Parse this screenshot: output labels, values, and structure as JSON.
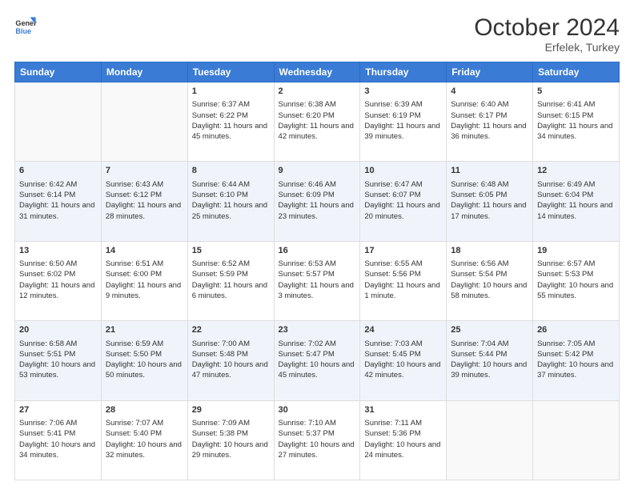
{
  "logo": {
    "general": "General",
    "blue": "Blue"
  },
  "title": {
    "month_year": "October 2024",
    "location": "Erfelek, Turkey"
  },
  "headers": [
    "Sunday",
    "Monday",
    "Tuesday",
    "Wednesday",
    "Thursday",
    "Friday",
    "Saturday"
  ],
  "weeks": [
    [
      {
        "day": "",
        "sunrise": "",
        "sunset": "",
        "daylight": ""
      },
      {
        "day": "",
        "sunrise": "",
        "sunset": "",
        "daylight": ""
      },
      {
        "day": "1",
        "sunrise": "Sunrise: 6:37 AM",
        "sunset": "Sunset: 6:22 PM",
        "daylight": "Daylight: 11 hours and 45 minutes."
      },
      {
        "day": "2",
        "sunrise": "Sunrise: 6:38 AM",
        "sunset": "Sunset: 6:20 PM",
        "daylight": "Daylight: 11 hours and 42 minutes."
      },
      {
        "day": "3",
        "sunrise": "Sunrise: 6:39 AM",
        "sunset": "Sunset: 6:19 PM",
        "daylight": "Daylight: 11 hours and 39 minutes."
      },
      {
        "day": "4",
        "sunrise": "Sunrise: 6:40 AM",
        "sunset": "Sunset: 6:17 PM",
        "daylight": "Daylight: 11 hours and 36 minutes."
      },
      {
        "day": "5",
        "sunrise": "Sunrise: 6:41 AM",
        "sunset": "Sunset: 6:15 PM",
        "daylight": "Daylight: 11 hours and 34 minutes."
      }
    ],
    [
      {
        "day": "6",
        "sunrise": "Sunrise: 6:42 AM",
        "sunset": "Sunset: 6:14 PM",
        "daylight": "Daylight: 11 hours and 31 minutes."
      },
      {
        "day": "7",
        "sunrise": "Sunrise: 6:43 AM",
        "sunset": "Sunset: 6:12 PM",
        "daylight": "Daylight: 11 hours and 28 minutes."
      },
      {
        "day": "8",
        "sunrise": "Sunrise: 6:44 AM",
        "sunset": "Sunset: 6:10 PM",
        "daylight": "Daylight: 11 hours and 25 minutes."
      },
      {
        "day": "9",
        "sunrise": "Sunrise: 6:46 AM",
        "sunset": "Sunset: 6:09 PM",
        "daylight": "Daylight: 11 hours and 23 minutes."
      },
      {
        "day": "10",
        "sunrise": "Sunrise: 6:47 AM",
        "sunset": "Sunset: 6:07 PM",
        "daylight": "Daylight: 11 hours and 20 minutes."
      },
      {
        "day": "11",
        "sunrise": "Sunrise: 6:48 AM",
        "sunset": "Sunset: 6:05 PM",
        "daylight": "Daylight: 11 hours and 17 minutes."
      },
      {
        "day": "12",
        "sunrise": "Sunrise: 6:49 AM",
        "sunset": "Sunset: 6:04 PM",
        "daylight": "Daylight: 11 hours and 14 minutes."
      }
    ],
    [
      {
        "day": "13",
        "sunrise": "Sunrise: 6:50 AM",
        "sunset": "Sunset: 6:02 PM",
        "daylight": "Daylight: 11 hours and 12 minutes."
      },
      {
        "day": "14",
        "sunrise": "Sunrise: 6:51 AM",
        "sunset": "Sunset: 6:00 PM",
        "daylight": "Daylight: 11 hours and 9 minutes."
      },
      {
        "day": "15",
        "sunrise": "Sunrise: 6:52 AM",
        "sunset": "Sunset: 5:59 PM",
        "daylight": "Daylight: 11 hours and 6 minutes."
      },
      {
        "day": "16",
        "sunrise": "Sunrise: 6:53 AM",
        "sunset": "Sunset: 5:57 PM",
        "daylight": "Daylight: 11 hours and 3 minutes."
      },
      {
        "day": "17",
        "sunrise": "Sunrise: 6:55 AM",
        "sunset": "Sunset: 5:56 PM",
        "daylight": "Daylight: 11 hours and 1 minute."
      },
      {
        "day": "18",
        "sunrise": "Sunrise: 6:56 AM",
        "sunset": "Sunset: 5:54 PM",
        "daylight": "Daylight: 10 hours and 58 minutes."
      },
      {
        "day": "19",
        "sunrise": "Sunrise: 6:57 AM",
        "sunset": "Sunset: 5:53 PM",
        "daylight": "Daylight: 10 hours and 55 minutes."
      }
    ],
    [
      {
        "day": "20",
        "sunrise": "Sunrise: 6:58 AM",
        "sunset": "Sunset: 5:51 PM",
        "daylight": "Daylight: 10 hours and 53 minutes."
      },
      {
        "day": "21",
        "sunrise": "Sunrise: 6:59 AM",
        "sunset": "Sunset: 5:50 PM",
        "daylight": "Daylight: 10 hours and 50 minutes."
      },
      {
        "day": "22",
        "sunrise": "Sunrise: 7:00 AM",
        "sunset": "Sunset: 5:48 PM",
        "daylight": "Daylight: 10 hours and 47 minutes."
      },
      {
        "day": "23",
        "sunrise": "Sunrise: 7:02 AM",
        "sunset": "Sunset: 5:47 PM",
        "daylight": "Daylight: 10 hours and 45 minutes."
      },
      {
        "day": "24",
        "sunrise": "Sunrise: 7:03 AM",
        "sunset": "Sunset: 5:45 PM",
        "daylight": "Daylight: 10 hours and 42 minutes."
      },
      {
        "day": "25",
        "sunrise": "Sunrise: 7:04 AM",
        "sunset": "Sunset: 5:44 PM",
        "daylight": "Daylight: 10 hours and 39 minutes."
      },
      {
        "day": "26",
        "sunrise": "Sunrise: 7:05 AM",
        "sunset": "Sunset: 5:42 PM",
        "daylight": "Daylight: 10 hours and 37 minutes."
      }
    ],
    [
      {
        "day": "27",
        "sunrise": "Sunrise: 7:06 AM",
        "sunset": "Sunset: 5:41 PM",
        "daylight": "Daylight: 10 hours and 34 minutes."
      },
      {
        "day": "28",
        "sunrise": "Sunrise: 7:07 AM",
        "sunset": "Sunset: 5:40 PM",
        "daylight": "Daylight: 10 hours and 32 minutes."
      },
      {
        "day": "29",
        "sunrise": "Sunrise: 7:09 AM",
        "sunset": "Sunset: 5:38 PM",
        "daylight": "Daylight: 10 hours and 29 minutes."
      },
      {
        "day": "30",
        "sunrise": "Sunrise: 7:10 AM",
        "sunset": "Sunset: 5:37 PM",
        "daylight": "Daylight: 10 hours and 27 minutes."
      },
      {
        "day": "31",
        "sunrise": "Sunrise: 7:11 AM",
        "sunset": "Sunset: 5:36 PM",
        "daylight": "Daylight: 10 hours and 24 minutes."
      },
      {
        "day": "",
        "sunrise": "",
        "sunset": "",
        "daylight": ""
      },
      {
        "day": "",
        "sunrise": "",
        "sunset": "",
        "daylight": ""
      }
    ]
  ]
}
